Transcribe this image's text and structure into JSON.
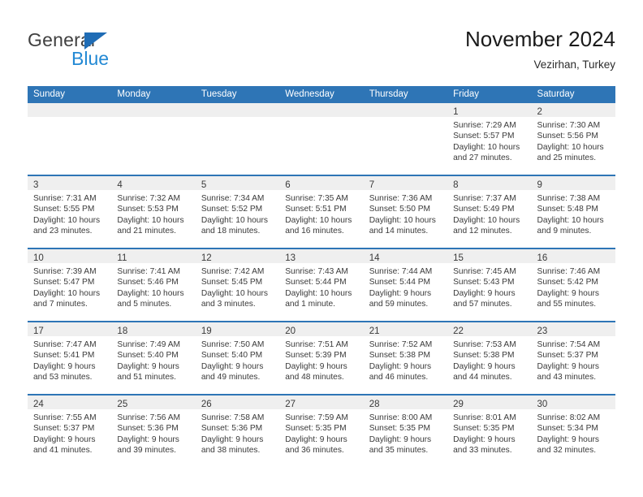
{
  "brand": {
    "name_part1": "General",
    "name_part2": "Blue",
    "triangle_icon": "triangle-flag-icon",
    "color_dark": "#404040",
    "color_blue": "#2389d4"
  },
  "header": {
    "title": "November 2024",
    "subtitle": "Vezirhan, Turkey"
  },
  "colors": {
    "header_bg": "#2e75b6",
    "header_text": "#ffffff",
    "daynum_band": "#efefef",
    "row_divider": "#2e75b6",
    "cell_text": "#3a3a3a"
  },
  "weekday_headers": [
    "Sunday",
    "Monday",
    "Tuesday",
    "Wednesday",
    "Thursday",
    "Friday",
    "Saturday"
  ],
  "weeks": [
    [
      {
        "day": "",
        "empty": true
      },
      {
        "day": "",
        "empty": true
      },
      {
        "day": "",
        "empty": true
      },
      {
        "day": "",
        "empty": true
      },
      {
        "day": "",
        "empty": true
      },
      {
        "day": "1",
        "sunrise": "Sunrise: 7:29 AM",
        "sunset": "Sunset: 5:57 PM",
        "daylight": "Daylight: 10 hours and 27 minutes."
      },
      {
        "day": "2",
        "sunrise": "Sunrise: 7:30 AM",
        "sunset": "Sunset: 5:56 PM",
        "daylight": "Daylight: 10 hours and 25 minutes."
      }
    ],
    [
      {
        "day": "3",
        "sunrise": "Sunrise: 7:31 AM",
        "sunset": "Sunset: 5:55 PM",
        "daylight": "Daylight: 10 hours and 23 minutes."
      },
      {
        "day": "4",
        "sunrise": "Sunrise: 7:32 AM",
        "sunset": "Sunset: 5:53 PM",
        "daylight": "Daylight: 10 hours and 21 minutes."
      },
      {
        "day": "5",
        "sunrise": "Sunrise: 7:34 AM",
        "sunset": "Sunset: 5:52 PM",
        "daylight": "Daylight: 10 hours and 18 minutes."
      },
      {
        "day": "6",
        "sunrise": "Sunrise: 7:35 AM",
        "sunset": "Sunset: 5:51 PM",
        "daylight": "Daylight: 10 hours and 16 minutes."
      },
      {
        "day": "7",
        "sunrise": "Sunrise: 7:36 AM",
        "sunset": "Sunset: 5:50 PM",
        "daylight": "Daylight: 10 hours and 14 minutes."
      },
      {
        "day": "8",
        "sunrise": "Sunrise: 7:37 AM",
        "sunset": "Sunset: 5:49 PM",
        "daylight": "Daylight: 10 hours and 12 minutes."
      },
      {
        "day": "9",
        "sunrise": "Sunrise: 7:38 AM",
        "sunset": "Sunset: 5:48 PM",
        "daylight": "Daylight: 10 hours and 9 minutes."
      }
    ],
    [
      {
        "day": "10",
        "sunrise": "Sunrise: 7:39 AM",
        "sunset": "Sunset: 5:47 PM",
        "daylight": "Daylight: 10 hours and 7 minutes."
      },
      {
        "day": "11",
        "sunrise": "Sunrise: 7:41 AM",
        "sunset": "Sunset: 5:46 PM",
        "daylight": "Daylight: 10 hours and 5 minutes."
      },
      {
        "day": "12",
        "sunrise": "Sunrise: 7:42 AM",
        "sunset": "Sunset: 5:45 PM",
        "daylight": "Daylight: 10 hours and 3 minutes."
      },
      {
        "day": "13",
        "sunrise": "Sunrise: 7:43 AM",
        "sunset": "Sunset: 5:44 PM",
        "daylight": "Daylight: 10 hours and 1 minute."
      },
      {
        "day": "14",
        "sunrise": "Sunrise: 7:44 AM",
        "sunset": "Sunset: 5:44 PM",
        "daylight": "Daylight: 9 hours and 59 minutes."
      },
      {
        "day": "15",
        "sunrise": "Sunrise: 7:45 AM",
        "sunset": "Sunset: 5:43 PM",
        "daylight": "Daylight: 9 hours and 57 minutes."
      },
      {
        "day": "16",
        "sunrise": "Sunrise: 7:46 AM",
        "sunset": "Sunset: 5:42 PM",
        "daylight": "Daylight: 9 hours and 55 minutes."
      }
    ],
    [
      {
        "day": "17",
        "sunrise": "Sunrise: 7:47 AM",
        "sunset": "Sunset: 5:41 PM",
        "daylight": "Daylight: 9 hours and 53 minutes."
      },
      {
        "day": "18",
        "sunrise": "Sunrise: 7:49 AM",
        "sunset": "Sunset: 5:40 PM",
        "daylight": "Daylight: 9 hours and 51 minutes."
      },
      {
        "day": "19",
        "sunrise": "Sunrise: 7:50 AM",
        "sunset": "Sunset: 5:40 PM",
        "daylight": "Daylight: 9 hours and 49 minutes."
      },
      {
        "day": "20",
        "sunrise": "Sunrise: 7:51 AM",
        "sunset": "Sunset: 5:39 PM",
        "daylight": "Daylight: 9 hours and 48 minutes."
      },
      {
        "day": "21",
        "sunrise": "Sunrise: 7:52 AM",
        "sunset": "Sunset: 5:38 PM",
        "daylight": "Daylight: 9 hours and 46 minutes."
      },
      {
        "day": "22",
        "sunrise": "Sunrise: 7:53 AM",
        "sunset": "Sunset: 5:38 PM",
        "daylight": "Daylight: 9 hours and 44 minutes."
      },
      {
        "day": "23",
        "sunrise": "Sunrise: 7:54 AM",
        "sunset": "Sunset: 5:37 PM",
        "daylight": "Daylight: 9 hours and 43 minutes."
      }
    ],
    [
      {
        "day": "24",
        "sunrise": "Sunrise: 7:55 AM",
        "sunset": "Sunset: 5:37 PM",
        "daylight": "Daylight: 9 hours and 41 minutes."
      },
      {
        "day": "25",
        "sunrise": "Sunrise: 7:56 AM",
        "sunset": "Sunset: 5:36 PM",
        "daylight": "Daylight: 9 hours and 39 minutes."
      },
      {
        "day": "26",
        "sunrise": "Sunrise: 7:58 AM",
        "sunset": "Sunset: 5:36 PM",
        "daylight": "Daylight: 9 hours and 38 minutes."
      },
      {
        "day": "27",
        "sunrise": "Sunrise: 7:59 AM",
        "sunset": "Sunset: 5:35 PM",
        "daylight": "Daylight: 9 hours and 36 minutes."
      },
      {
        "day": "28",
        "sunrise": "Sunrise: 8:00 AM",
        "sunset": "Sunset: 5:35 PM",
        "daylight": "Daylight: 9 hours and 35 minutes."
      },
      {
        "day": "29",
        "sunrise": "Sunrise: 8:01 AM",
        "sunset": "Sunset: 5:35 PM",
        "daylight": "Daylight: 9 hours and 33 minutes."
      },
      {
        "day": "30",
        "sunrise": "Sunrise: 8:02 AM",
        "sunset": "Sunset: 5:34 PM",
        "daylight": "Daylight: 9 hours and 32 minutes."
      }
    ]
  ]
}
